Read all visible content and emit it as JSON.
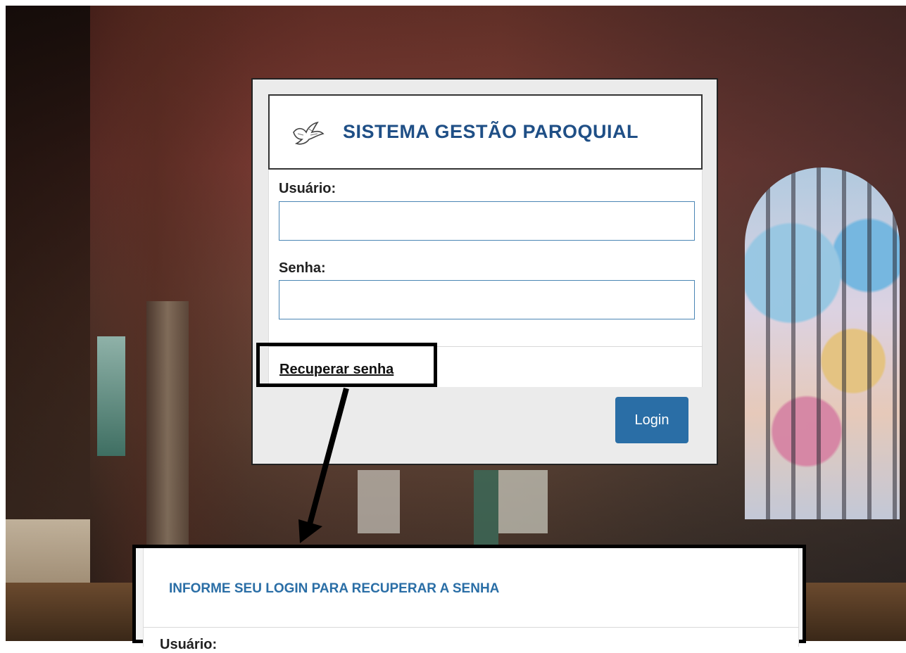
{
  "app": {
    "title": "SISTEMA GESTÃO PAROQUIAL",
    "logo_icon": "dove-icon"
  },
  "login_form": {
    "username_label": "Usuário:",
    "username_value": "",
    "password_label": "Senha:",
    "password_value": "",
    "recover_link": "Recuperar senha",
    "login_button": "Login"
  },
  "recover_panel": {
    "title": "INFORME SEU LOGIN PARA RECUPERAR A SENHA",
    "field_label": "Usuário:"
  },
  "colors": {
    "title_blue": "#1f4f86",
    "button_blue": "#2a6ea6",
    "input_border": "#4b86b4"
  }
}
